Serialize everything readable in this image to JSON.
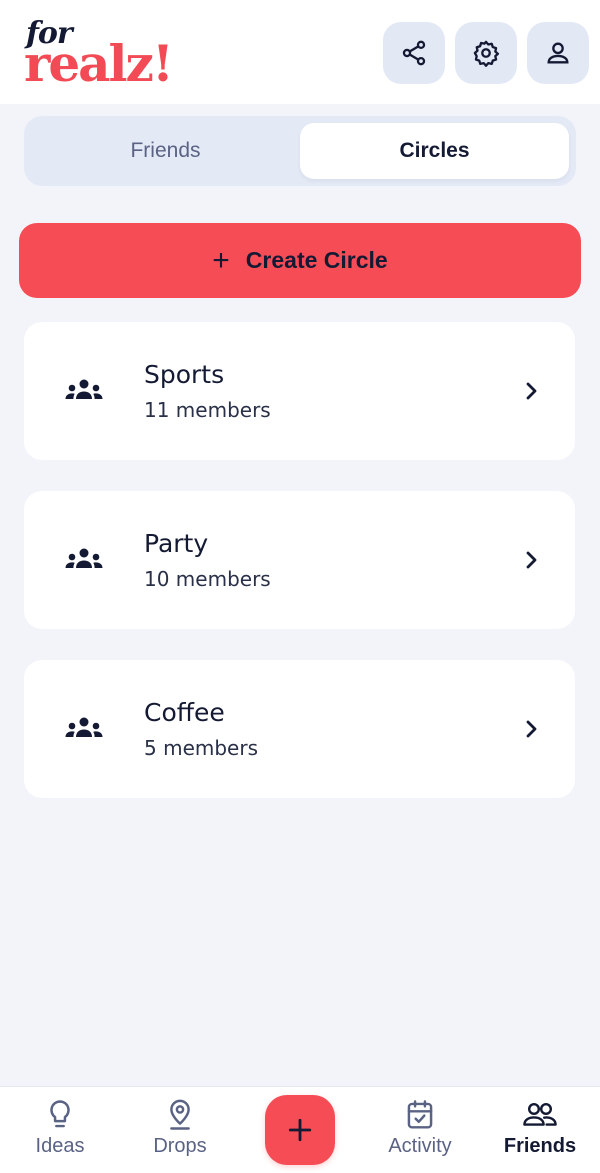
{
  "app": {
    "logo_top": "for",
    "logo_bottom": "realz!",
    "brand_color": "#f24b55",
    "dark_color": "#141a33"
  },
  "header": {
    "buttons": [
      {
        "icon": "share-icon"
      },
      {
        "icon": "gear-icon"
      },
      {
        "icon": "profile-icon"
      }
    ]
  },
  "tabs": [
    {
      "label": "Friends",
      "active": false
    },
    {
      "label": "Circles",
      "active": true
    }
  ],
  "create_button": {
    "icon": "plus-icon",
    "label": "Create Circle"
  },
  "circles": [
    {
      "name": "Sports",
      "members": "11 members"
    },
    {
      "name": "Party",
      "members": "10 members"
    },
    {
      "name": "Coffee",
      "members": "5 members"
    }
  ],
  "bottom_nav": {
    "items": [
      {
        "label": "Ideas",
        "icon": "lightbulb-icon"
      },
      {
        "label": "Drops",
        "icon": "location-pin-icon"
      },
      {
        "label": "Activity",
        "icon": "calendar-check-icon"
      },
      {
        "label": "Friends",
        "icon": "friends-icon",
        "active": true
      }
    ],
    "fab_icon": "plus-icon"
  }
}
